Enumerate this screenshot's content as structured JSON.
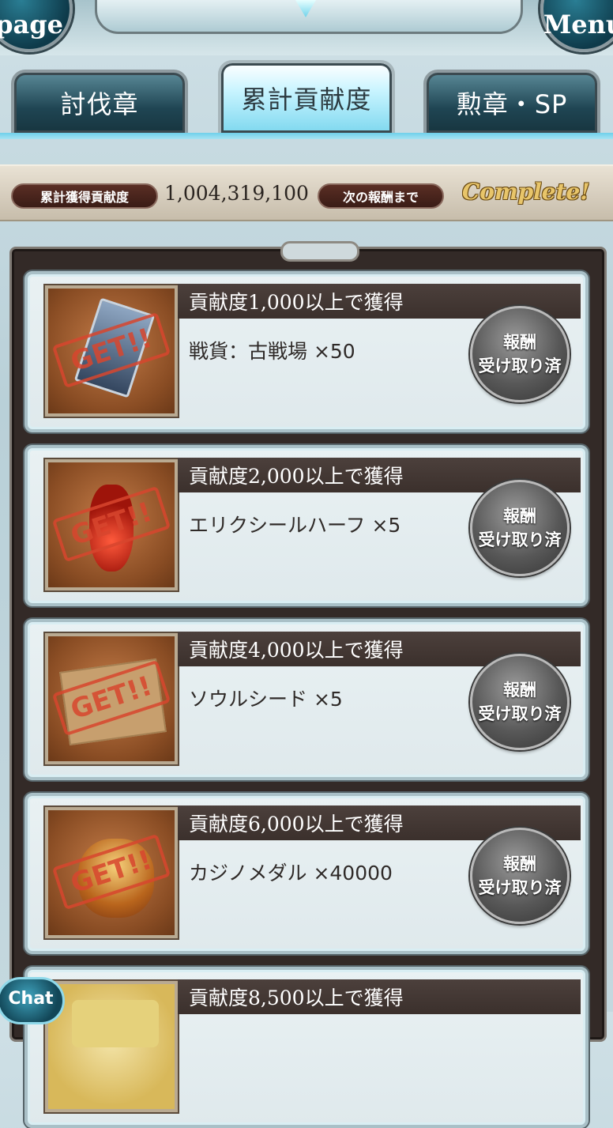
{
  "header": {
    "left_button": "page",
    "right_button": "Menu"
  },
  "tabs": [
    {
      "label": "討伐章"
    },
    {
      "label": "累計貢献度"
    },
    {
      "label": "勲章・SP"
    }
  ],
  "summary": {
    "total_label": "累計獲得貢献度",
    "total_value": "1,004,319,100",
    "next_label": "次の報酬まで",
    "status": "Complete!"
  },
  "rewards": [
    {
      "requirement": "貢献度1,000以上で獲得",
      "item": "戦貨：古戦場 ×50",
      "stamp": "GET!!",
      "status_line1": "報酬",
      "status_line2": "受け取り済"
    },
    {
      "requirement": "貢献度2,000以上で獲得",
      "item": "エリクシールハーフ ×5",
      "stamp": "GET!!",
      "status_line1": "報酬",
      "status_line2": "受け取り済"
    },
    {
      "requirement": "貢献度4,000以上で獲得",
      "item": "ソウルシード ×5",
      "stamp": "GET!!",
      "status_line1": "報酬",
      "status_line2": "受け取り済"
    },
    {
      "requirement": "貢献度6,000以上で獲得",
      "item": "カジノメダル ×40000",
      "stamp": "GET!!",
      "status_line1": "報酬",
      "status_line2": "受け取り済"
    },
    {
      "requirement": "貢献度8,500以上で獲得"
    }
  ],
  "chat": {
    "label": "Chat"
  },
  "colors": {
    "tab_active": "#c8f4ff",
    "pill_bg": "#3a1c16",
    "complete_gold": "#e8c56a",
    "stamp_red": "#d8462e"
  }
}
